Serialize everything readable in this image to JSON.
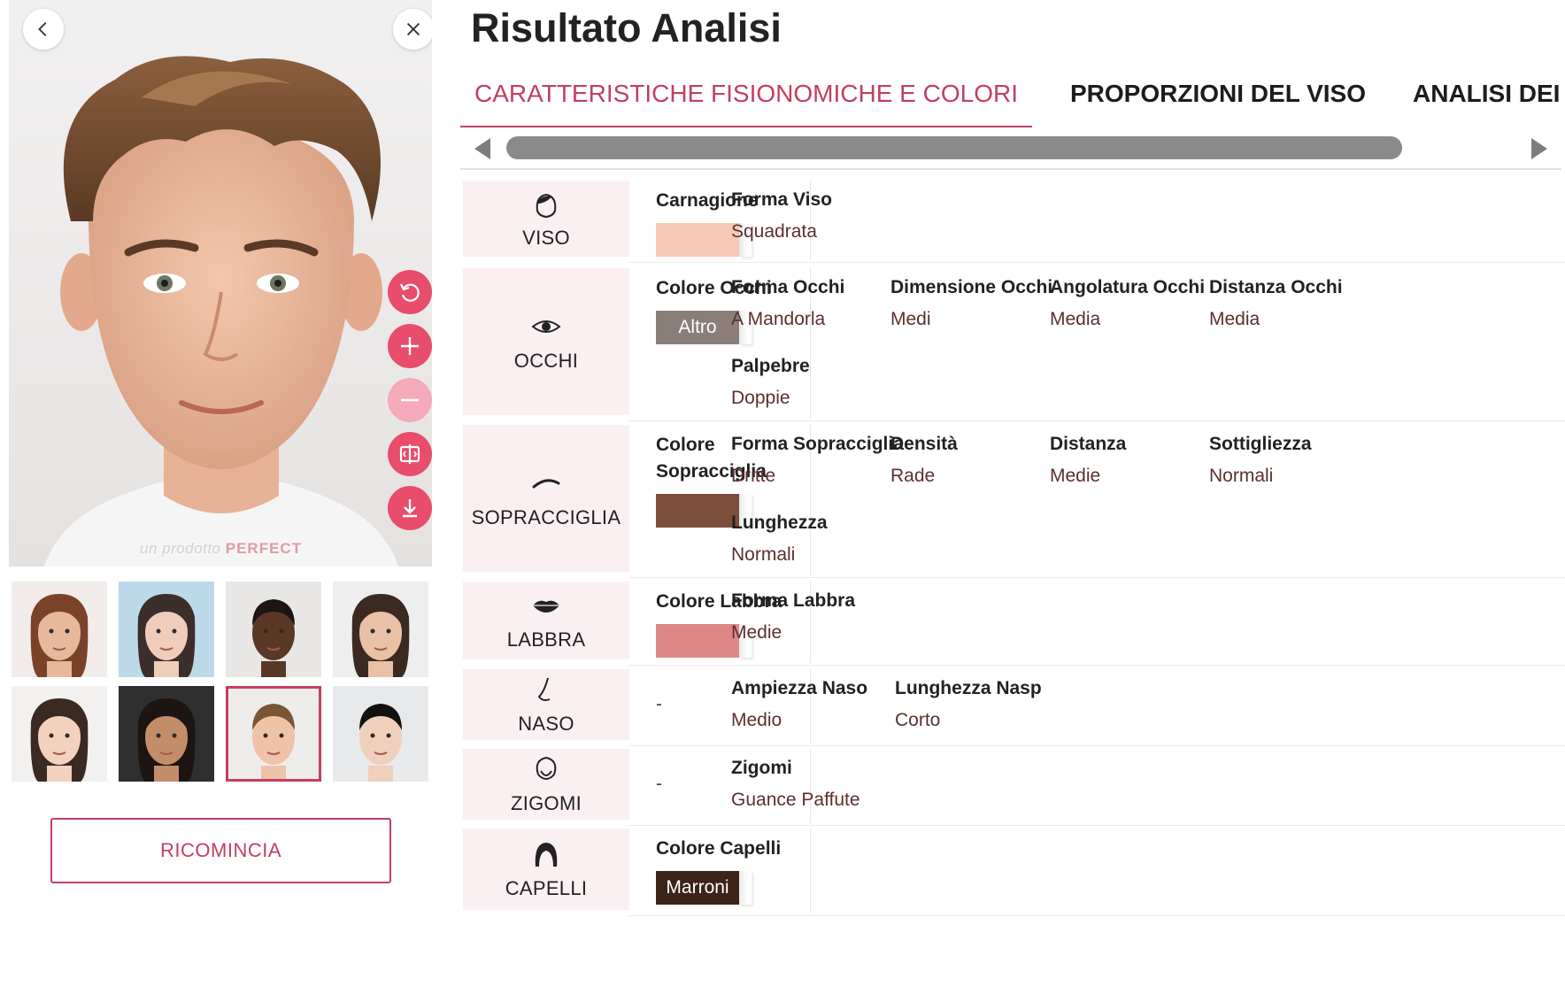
{
  "page": {
    "title": "Risultato Analisi"
  },
  "tabs": [
    {
      "label": "CARATTERISTICHE FISIONOMICHE E COLORI",
      "active": true
    },
    {
      "label": "PROPORZIONI DEL VISO",
      "active": false
    },
    {
      "label": "ANALISI DEI",
      "active": false
    }
  ],
  "photo": {
    "watermark_prefix": "un prodotto",
    "watermark_brand": "PERFECT"
  },
  "icons": {
    "back": "chevron-left-icon",
    "close": "close-icon",
    "rotate": "rotate-icon",
    "zoom_in": "plus-icon",
    "zoom_out": "minus-icon",
    "compare": "compare-icon",
    "download": "download-icon"
  },
  "colors": {
    "accent": "#c2405f",
    "accent_button": "#e84d6c",
    "category_bg": "#fbf0f1",
    "scrollbar": "#8a8a8a"
  },
  "thumbnails": {
    "count": 8,
    "selected_index": 6
  },
  "restart_button": "RICOMINCIA",
  "analysis": [
    {
      "category": "VISO",
      "icon": "face-icon",
      "color_title": "Carnagione",
      "swatch": {
        "color": "#f6c8b5",
        "text": ""
      },
      "attributes": [
        {
          "title": "Forma Viso",
          "value": "Squadrata"
        }
      ]
    },
    {
      "category": "OCCHI",
      "icon": "eye-icon",
      "color_title": "Colore Occhi",
      "swatch": {
        "color": "#8a7f78",
        "text": "Altro"
      },
      "attributes": [
        {
          "title": "Forma Occhi",
          "value": "A Mandorla"
        },
        {
          "title": "Dimensione Occhi",
          "value": "Medi"
        },
        {
          "title": "Angolatura Occhi",
          "value": "Media"
        },
        {
          "title": "Distanza Occhi",
          "value": "Media"
        },
        {
          "title": "Palpebre",
          "value": "Doppie"
        }
      ]
    },
    {
      "category": "SOPRACCIGLIA",
      "icon": "eyebrow-icon",
      "color_title": "Colore Sopracciglia",
      "swatch": {
        "color": "#7a4e3a",
        "text": ""
      },
      "attributes": [
        {
          "title": "Forma Sopracciglia",
          "value": "Dritte"
        },
        {
          "title": "Densità",
          "value": "Rade"
        },
        {
          "title": "Distanza",
          "value": "Medie"
        },
        {
          "title": "Sottigliezza",
          "value": "Normali"
        },
        {
          "title": "Lunghezza",
          "value": "Normali"
        }
      ]
    },
    {
      "category": "LABBRA",
      "icon": "lips-icon",
      "color_title": "Colore Labbra",
      "swatch": {
        "color": "#de8787",
        "text": ""
      },
      "attributes": [
        {
          "title": "Forma Labbra",
          "value": "Medie"
        }
      ]
    },
    {
      "category": "NASO",
      "icon": "nose-icon",
      "color_title": "",
      "dash": "-",
      "attributes": [
        {
          "title": "Ampiezza Naso",
          "value": "Medio"
        },
        {
          "title": "Lunghezza Nasp",
          "value": "Corto"
        }
      ]
    },
    {
      "category": "ZIGOMI",
      "icon": "cheekbones-icon",
      "color_title": "",
      "dash": "-",
      "attributes": [
        {
          "title": "Zigomi",
          "value": "Guance Paffute"
        }
      ]
    },
    {
      "category": "CAPELLI",
      "icon": "hair-icon",
      "color_title": "Colore Capelli",
      "swatch": {
        "color": "#3d2418",
        "text": "Marroni"
      },
      "attributes": []
    }
  ]
}
